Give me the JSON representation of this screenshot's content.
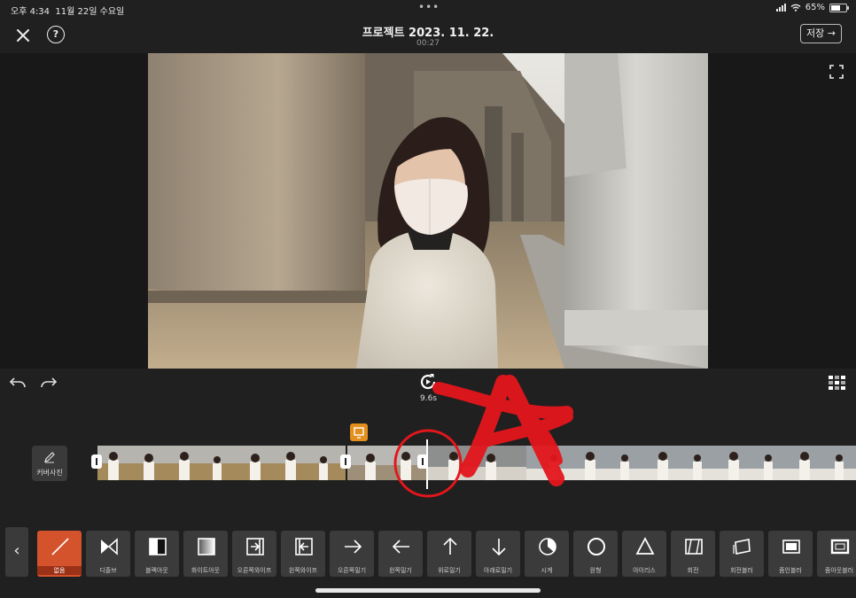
{
  "status": {
    "time": "오후 4:34",
    "date": "11월 22일 수요일",
    "dots": "•••",
    "battery": "65%"
  },
  "header": {
    "title": "프로젝트 2023. 11. 22.",
    "duration": "00:27",
    "save_label": "저장 →"
  },
  "controls": {
    "clip_time": "9.6s"
  },
  "timeline": {
    "cover_label": "커버사진"
  },
  "transitions": [
    {
      "label": "없음",
      "icon": "none-slash-icon",
      "selected": true
    },
    {
      "label": "디졸브",
      "icon": "dissolve-icon"
    },
    {
      "label": "블랙아웃",
      "icon": "blackout-icon"
    },
    {
      "label": "화이트아웃",
      "icon": "whiteout-icon"
    },
    {
      "label": "오른쪽와이프",
      "icon": "wipe-right-icon"
    },
    {
      "label": "왼쪽와이프",
      "icon": "wipe-left-icon"
    },
    {
      "label": "오른쪽밀기",
      "icon": "arrow-right-icon"
    },
    {
      "label": "왼쪽밀기",
      "icon": "arrow-left-icon"
    },
    {
      "label": "위로밀기",
      "icon": "arrow-up-icon"
    },
    {
      "label": "아래로밀기",
      "icon": "arrow-down-icon"
    },
    {
      "label": "시계",
      "icon": "clock-wipe-icon"
    },
    {
      "label": "원형",
      "icon": "circle-icon"
    },
    {
      "label": "아이리스",
      "icon": "iris-triangle-icon"
    },
    {
      "label": "회전",
      "icon": "rotate-icon"
    },
    {
      "label": "회전블러",
      "icon": "rotate-blur-icon"
    },
    {
      "label": "줌인블러",
      "icon": "zoom-in-blur-icon"
    },
    {
      "label": "줌아웃블러",
      "icon": "zoom-out-blur-icon"
    }
  ],
  "colors": {
    "accent": "#d4532c",
    "marker": "#e38f1d",
    "annotation": "#e3161c"
  }
}
